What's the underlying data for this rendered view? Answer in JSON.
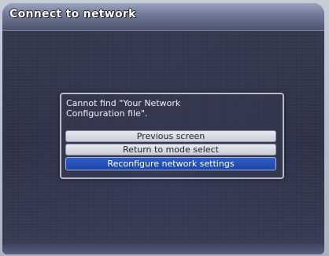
{
  "window": {
    "title": "Connect to network"
  },
  "dialog": {
    "message": "Cannot find \"Your Network\nConfiguration file\".",
    "options": [
      {
        "label": "Previous screen",
        "selected": false
      },
      {
        "label": "Return to mode select",
        "selected": false
      },
      {
        "label": "Reconfigure network settings",
        "selected": true
      }
    ]
  },
  "colors": {
    "selected_option": "#1c45a8",
    "background": "#2b2f44"
  }
}
